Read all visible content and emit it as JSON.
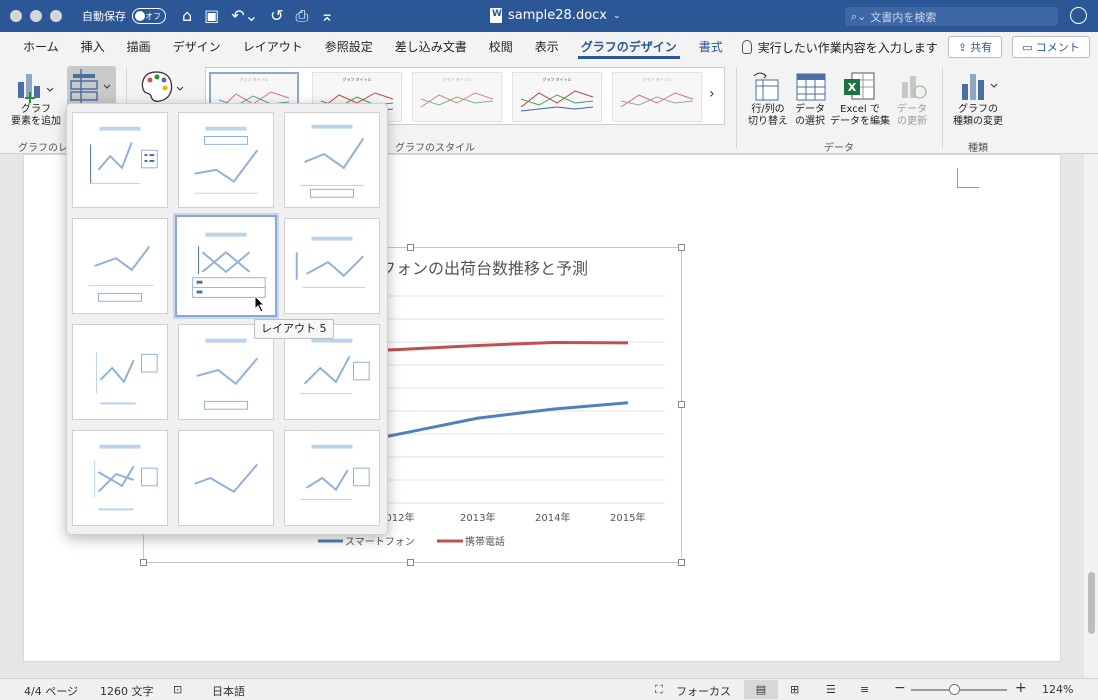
{
  "titlebar": {
    "autosave_label": "自動保存",
    "autosave_state": "オフ",
    "doc_name": "sample28.docx",
    "search_placeholder": "文書内を検索"
  },
  "tabs": [
    {
      "label": "ホーム"
    },
    {
      "label": "挿入"
    },
    {
      "label": "描画"
    },
    {
      "label": "デザイン"
    },
    {
      "label": "レイアウト"
    },
    {
      "label": "参照設定"
    },
    {
      "label": "差し込み文書"
    },
    {
      "label": "校閲"
    },
    {
      "label": "表示"
    },
    {
      "label": "グラフのデザイン"
    },
    {
      "label": "書式"
    }
  ],
  "tellme": "実行したい作業内容を入力します",
  "share_label": "共有",
  "comment_label": "コメント",
  "ribbon": {
    "add_element": "グラフ\n要素を追加",
    "group_layout": "グラフのレ",
    "group_styles": "グラフのスタイル",
    "switch_rowcol": "行/列の\n切り替え",
    "select_data": "データ\nの選択",
    "edit_excel": "Excel で\nデータを編集",
    "refresh_data": "データ\nの更新",
    "group_data": "データ",
    "change_type": "グラフの\n種類の変更",
    "group_type": "種類",
    "thumb_title": "グラフ タイトル"
  },
  "chart": {
    "title": "フォンの出荷台数推移と予測",
    "legend": [
      "スマートフォン",
      "携帯電話"
    ]
  },
  "chart_data": {
    "type": "line",
    "title": "フォンの出荷台数推移と予測",
    "categories": [
      "2012年",
      "2013年",
      "2014年",
      "2015年"
    ],
    "series": [
      {
        "name": "スマートフォン",
        "values": [
          2980,
          3690,
          4080,
          4360
        ],
        "color": "#4f81bd"
      },
      {
        "name": "携帯電話",
        "values": [
          6670,
          6850,
          6980,
          6960
        ],
        "color": "#c0504d"
      }
    ],
    "ylim": [
      0,
      9000
    ],
    "grid": true,
    "legend": "bottom"
  },
  "tooltip": "レイアウト 5",
  "statusbar": {
    "page": "4/4 ページ",
    "words": "1260 文字",
    "language": "日本語",
    "focus": "フォーカス",
    "zoom": "124%",
    "zoom_level": 0.45
  },
  "colors": {
    "accent": "#2b5797",
    "layout_blue": "#4a6fa5",
    "layout_light": "#bcd3ee"
  }
}
